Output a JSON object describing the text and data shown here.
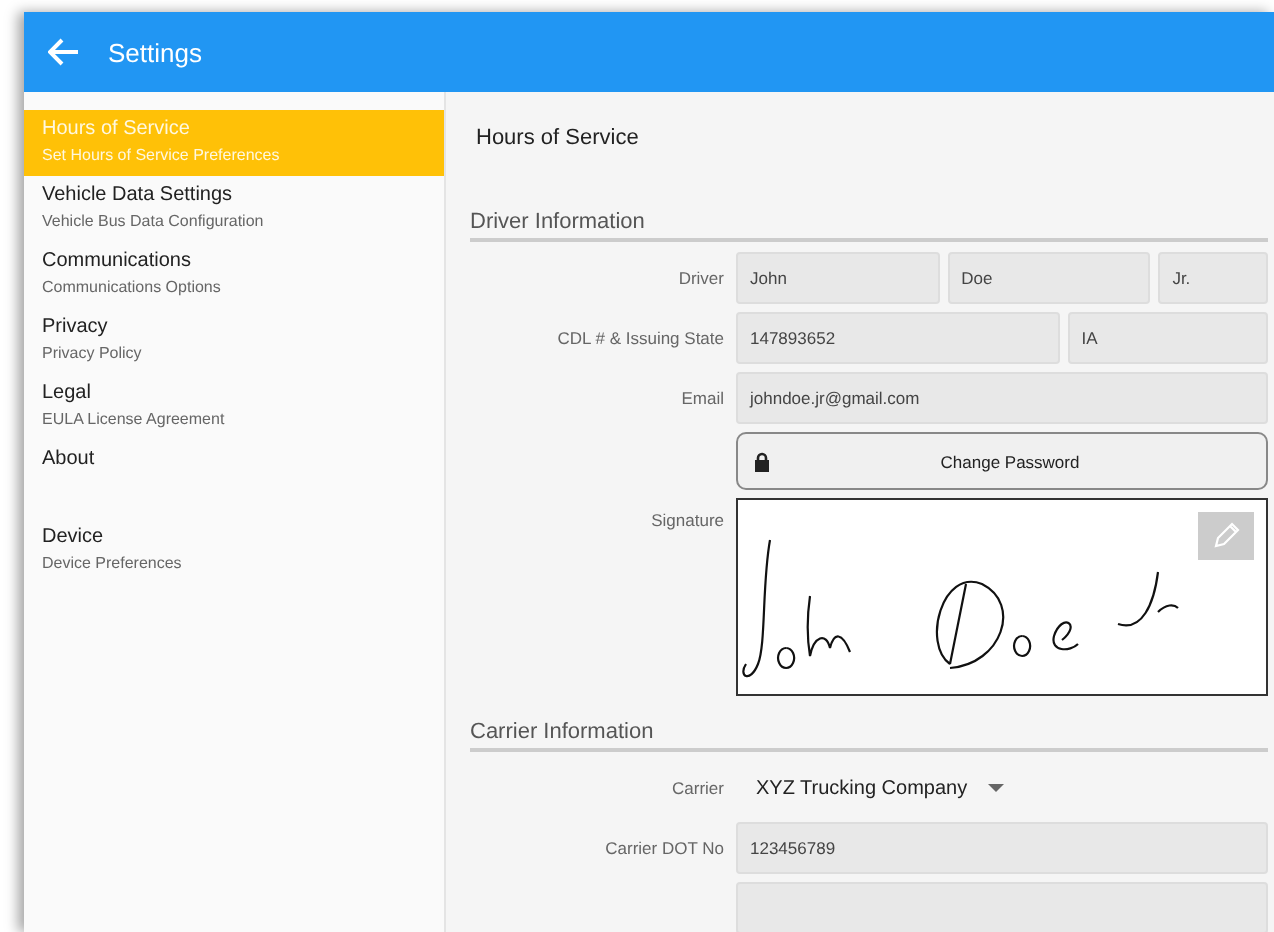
{
  "app_bar": {
    "title": "Settings"
  },
  "sidebar": {
    "items": [
      {
        "title": "Hours of Service",
        "subtitle": "Set Hours of Service Preferences",
        "selected": true
      },
      {
        "title": "Vehicle Data Settings",
        "subtitle": "Vehicle Bus Data Configuration",
        "selected": false
      },
      {
        "title": "Communications",
        "subtitle": "Communications Options",
        "selected": false
      },
      {
        "title": "Privacy",
        "subtitle": "Privacy Policy",
        "selected": false
      },
      {
        "title": "Legal",
        "subtitle": "EULA License Agreement",
        "selected": false
      },
      {
        "title": "About",
        "selected": false
      },
      {
        "title": "Device",
        "subtitle": "Device Preferences",
        "selected": false
      }
    ]
  },
  "content": {
    "title": "Hours of Service",
    "sections": [
      {
        "heading": "Driver Information",
        "rows": [
          {
            "kind": "fields",
            "label": "Driver",
            "fields": [
              {
                "value": "John"
              },
              {
                "value": "Doe"
              },
              {
                "value": "Jr."
              }
            ]
          },
          {
            "kind": "fields",
            "label": "CDL # & Issuing State",
            "fields": [
              {
                "value": "147893652"
              },
              {
                "value": "IA"
              }
            ]
          },
          {
            "kind": "fields",
            "label": "Email",
            "fields": [
              {
                "value": "johndoe.jr@gmail.com"
              }
            ]
          },
          {
            "kind": "button",
            "label": "Change Password"
          },
          {
            "kind": "signature",
            "label": "Signature"
          }
        ]
      },
      {
        "heading": "Carrier Information",
        "rows": [
          {
            "kind": "dropdown",
            "label": "Carrier",
            "value": "XYZ Trucking Company"
          },
          {
            "kind": "fields",
            "label": "Carrier DOT No",
            "fields": [
              {
                "value": "123456789"
              }
            ]
          },
          {
            "kind": "blank_field"
          }
        ]
      }
    ]
  }
}
